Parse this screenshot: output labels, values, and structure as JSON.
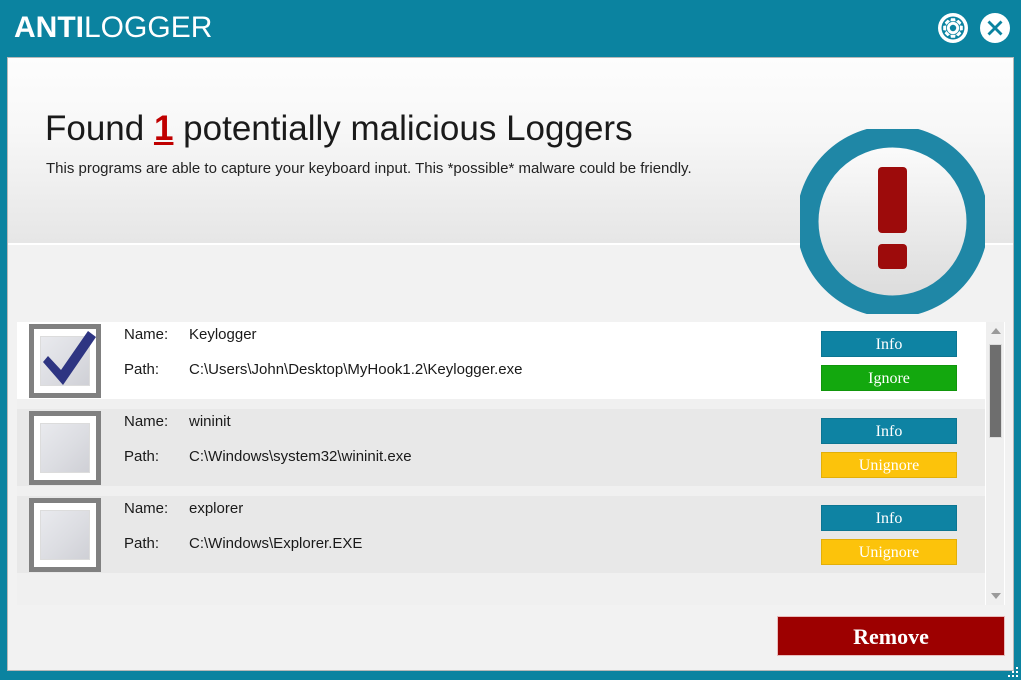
{
  "titlebar": {
    "brand_bold": "ANTI",
    "brand_light": "LOGGER",
    "settings_icon": "gear-icon",
    "close_icon": "close-icon",
    "background_color": "#0b83a0"
  },
  "hero": {
    "title_prefix": "Found ",
    "count": "1",
    "title_suffix": " potentially malicious Loggers",
    "subtitle": "This programs are able to capture your keyboard input. This *possible* malware could be friendly.",
    "warning_icon": "exclamation-circle-icon",
    "warning_ring_color": "#1f87a6",
    "warning_mark_color": "#9d0b0b",
    "count_color": "#c00000"
  },
  "list": {
    "labels": {
      "name": "Name:",
      "path": "Path:"
    },
    "rows": [
      {
        "checked": true,
        "name": "Keylogger",
        "path": "C:\\Users\\John\\Desktop\\MyHook1.2\\Keylogger.exe",
        "info_label": "Info",
        "action_label": "Ignore",
        "action_kind": "ignore"
      },
      {
        "checked": false,
        "name": "wininit",
        "path": "C:\\Windows\\system32\\wininit.exe",
        "info_label": "Info",
        "action_label": "Unignore",
        "action_kind": "unignore"
      },
      {
        "checked": false,
        "name": "explorer",
        "path": "C:\\Windows\\Explorer.EXE",
        "info_label": "Info",
        "action_label": "Unignore",
        "action_kind": "unignore"
      }
    ],
    "scrollbar": {
      "up_arrow_icon": "chevron-up-icon",
      "down_arrow_icon": "chevron-down-icon"
    }
  },
  "footer": {
    "remove_label": "Remove",
    "remove_color": "#9d0000",
    "resize_grip_icon": "resize-grip-icon"
  },
  "colors": {
    "info_button": "#0e83a3",
    "ignore_button": "#13a80e",
    "unignore_button": "#fcc30b"
  }
}
